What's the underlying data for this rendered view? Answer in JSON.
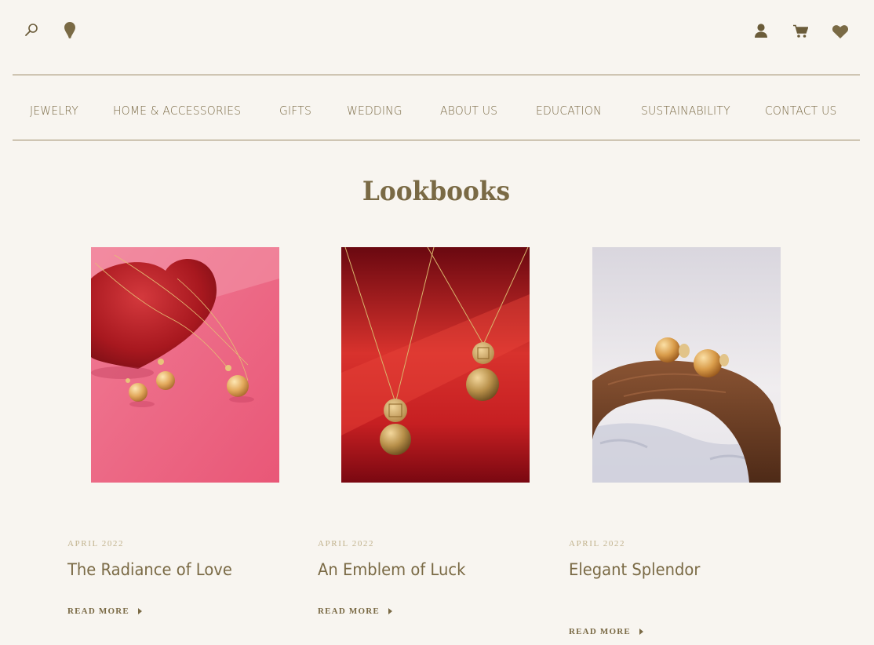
{
  "header": {
    "left_icons": [
      "search-icon",
      "location-pin-icon"
    ],
    "right_icons": [
      "account-icon",
      "cart-icon",
      "wishlist-heart-icon"
    ]
  },
  "nav": {
    "items": [
      {
        "label": "JEWELRY"
      },
      {
        "label": "HOME & ACCESSORIES"
      },
      {
        "label": "GIFTS"
      },
      {
        "label": "WEDDING"
      },
      {
        "label": "ABOUT US"
      },
      {
        "label": "EDUCATION"
      },
      {
        "label": "SUSTAINABILITY"
      },
      {
        "label": "CONTACT US"
      }
    ]
  },
  "page": {
    "title": "Lookbooks"
  },
  "lookbooks": [
    {
      "date": "APRIL 2022",
      "title": "The Radiance of Love",
      "cta": "READ MORE"
    },
    {
      "date": "APRIL 2022",
      "title": "An Emblem of Luck",
      "cta": "READ MORE"
    },
    {
      "date": "APRIL 2022",
      "title": "Elegant Splendor",
      "cta": "READ MORE"
    }
  ],
  "colors": {
    "background": "#f8f5f0",
    "brand_text": "#7a6a45",
    "date_text": "#c1b28d",
    "rule": "#9b8a66"
  }
}
